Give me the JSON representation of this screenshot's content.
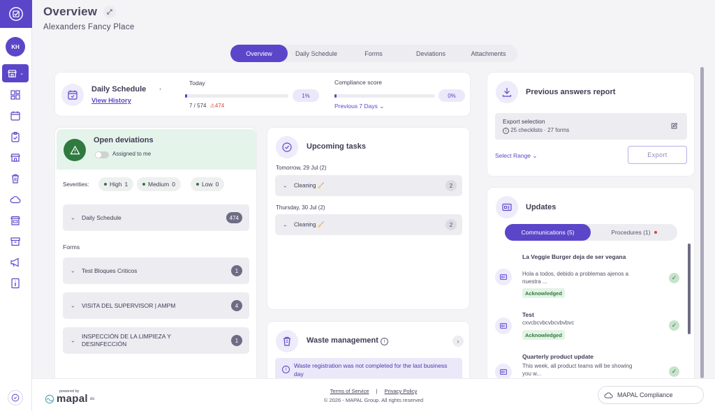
{
  "sidebar": {
    "avatar_initials": "KH",
    "icons": [
      "dashboard-icon",
      "schedule-icon",
      "clipboard-icon",
      "store-icon",
      "trash-icon",
      "cloud-icon",
      "storefront-icon",
      "archive-icon",
      "megaphone-icon",
      "info-icon"
    ]
  },
  "header": {
    "title": "Overview",
    "subtitle": "Alexanders Fancy Place"
  },
  "tabs": [
    {
      "label": "Overview",
      "active": true
    },
    {
      "label": "Daily Schedule"
    },
    {
      "label": "Forms"
    },
    {
      "label": "Deviations"
    },
    {
      "label": "Attachments"
    }
  ],
  "daily_schedule": {
    "title": "Daily Schedule",
    "view_history": "View History",
    "today_label": "Today",
    "today_progress": 0.01,
    "today_pct": "1%",
    "done_count": "7 / 574",
    "overdue_count": "474",
    "compliance_label": "Compliance score",
    "compliance_progress": 0,
    "compliance_pct": "0%",
    "range": "Previous 7 Days"
  },
  "open_deviations": {
    "title": "Open deviations",
    "assigned_to_me": "Assigned to me",
    "severities_label": "Severities:",
    "severities": [
      {
        "label": "High",
        "count": "1"
      },
      {
        "label": "Medium",
        "count": "0"
      },
      {
        "label": "Low",
        "count": "0"
      }
    ],
    "schedule_item": {
      "label": "Daily Schedule",
      "count": "474"
    },
    "forms_label": "Forms",
    "forms": [
      {
        "label": "Test Bloques Criticos",
        "count": "1"
      },
      {
        "label": "VISITA DEL SUPERVISOR | AMPM",
        "count": "4"
      },
      {
        "label": "INSPECCIÓN DE LA LIMPIEZA Y DESINFECCIÓN",
        "count": "1"
      }
    ]
  },
  "upcoming_tasks": {
    "title": "Upcoming tasks",
    "groups": [
      {
        "date": "Tomorrow, 29 Jul",
        "count": "(2)",
        "item": "Cleaning",
        "item_count": "2"
      },
      {
        "date": "Thursday, 30 Jul",
        "count": "(2)",
        "item": "Cleaning",
        "item_count": "2"
      }
    ]
  },
  "waste": {
    "title": "Waste management",
    "alert": "Waste registration was not completed for the last business day"
  },
  "previous_answers": {
    "title": "Previous answers report",
    "export_selection": "Export selection",
    "export_detail": "25 checklists · 27 forms",
    "select_range": "Select Range",
    "export_button": "Export"
  },
  "updates": {
    "title": "Updates",
    "tab_comms": "Communications (5)",
    "tab_procedures": "Procedures (1)",
    "items": [
      {
        "title": "La Veggie Burger deja de ser vegana",
        "body": "Hola a todos, debido a problemas ajenos a nuestra ...",
        "badge": "Acknowledged"
      },
      {
        "title": "Test",
        "body": "cxvcbcvbcvbcvbvbvc",
        "badge": "Acknowledged"
      },
      {
        "title": "Quarterly product update",
        "body": "This week, all product teams will be showing you w...",
        "badge": ""
      }
    ]
  },
  "footer": {
    "powered_by": "powered by",
    "brand": "mapal",
    "brand_suffix": "os",
    "terms": "Terms of Service",
    "separator": "|",
    "privacy": "Privacy Policy",
    "copyright": "© 2026 - MAPAL Group. All rights reserved",
    "compliance_button": "MAPAL Compliance"
  },
  "colors": {
    "accent": "#5b46c9",
    "success": "#2f7a3e",
    "danger": "#d64545"
  }
}
